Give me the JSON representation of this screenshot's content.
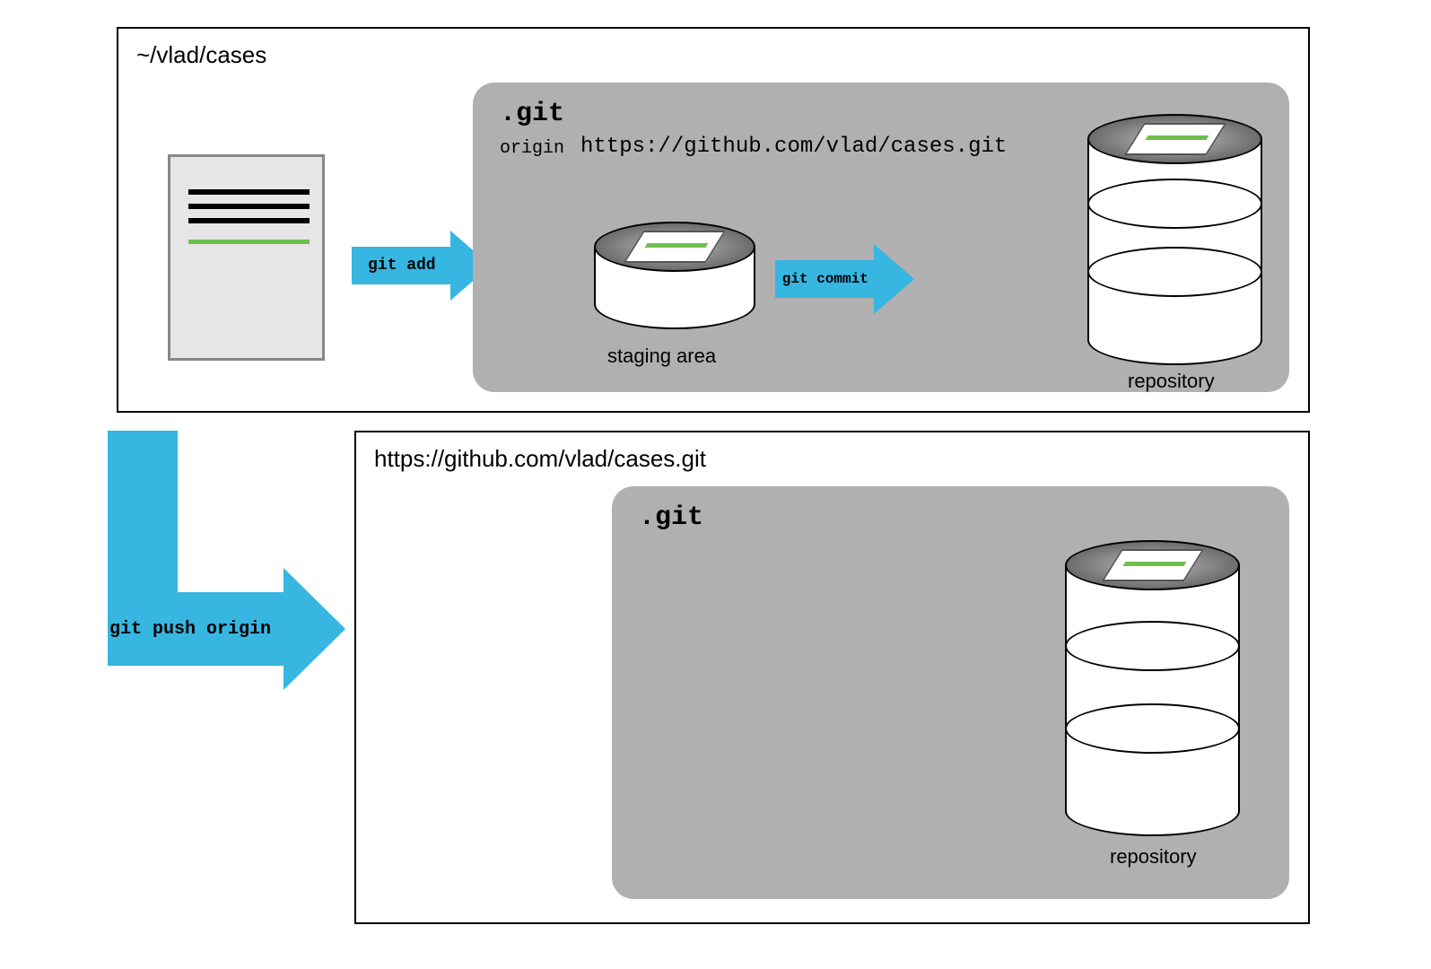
{
  "local": {
    "path": "~/vlad/cases",
    "git_label": ".git",
    "origin_label": "origin",
    "origin_url": "https://github.com/vlad/cases.git",
    "staging_label": "staging area",
    "repository_label": "repository"
  },
  "arrows": {
    "add": "git add",
    "commit": "git commit",
    "push": "git push origin"
  },
  "remote": {
    "url": "https://github.com/vlad/cases.git",
    "git_label": ".git",
    "repository_label": "repository"
  }
}
